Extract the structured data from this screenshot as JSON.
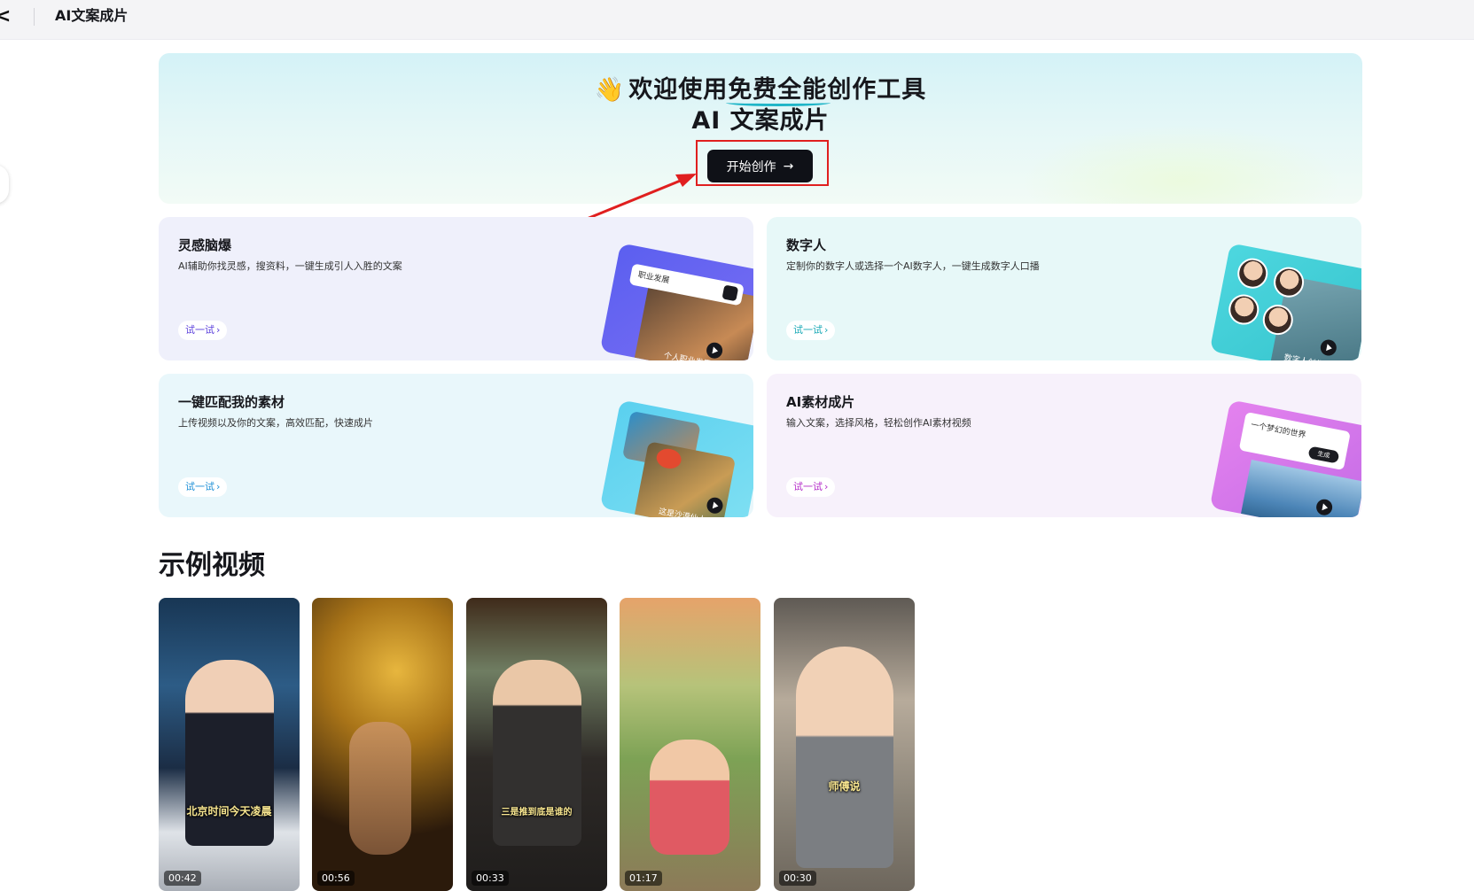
{
  "topbar": {
    "back_icon": "<",
    "title": "AI文案成片"
  },
  "hero": {
    "wave_emoji": "👋",
    "line1_pre": "欢迎使用",
    "line1_highlight": "免费全能",
    "line1_post": "创作工具",
    "line2": "AI 文案成片",
    "start_label": "开始创作",
    "start_arrow": "→",
    "annotation_color": "#e01f1f"
  },
  "features": [
    {
      "title": "灵感脑爆",
      "desc": "AI辅助你找灵感，搜资料，一键生成引人入胜的文案",
      "try_label": "试一试",
      "accent": "#5b3fdc",
      "illo_bar": "职业发展",
      "illo_caption": "个人职业发展"
    },
    {
      "title": "数字人",
      "desc": "定制你的数字人或选择一个AI数字人，一键生成数字人口播",
      "try_label": "试一试",
      "accent": "#17a8b5",
      "illo_caption": "数字人创作"
    },
    {
      "title": "一键匹配我的素材",
      "desc": "上传视频以及你的文案，高效匹配，快速成片",
      "try_label": "试一试",
      "accent": "#1d8fd6",
      "illo_caption": "这是沙漠仙人"
    },
    {
      "title": "AI素材成片",
      "desc": "输入文案，选择风格，轻松创作AI素材视频",
      "try_label": "试一试",
      "accent": "#b42cc9",
      "illo_prompt": "一个梦幻的世界",
      "illo_gen": "生成"
    }
  ],
  "examples": {
    "heading": "示例视频",
    "videos": [
      {
        "caption": "北京时间今天凌晨",
        "duration": "00:42"
      },
      {
        "caption": "",
        "duration": "00:56"
      },
      {
        "caption": "三是推到底是谁的",
        "duration": "00:33"
      },
      {
        "caption": "",
        "duration": "01:17"
      },
      {
        "caption": "师傅说",
        "duration": "00:30"
      }
    ]
  }
}
